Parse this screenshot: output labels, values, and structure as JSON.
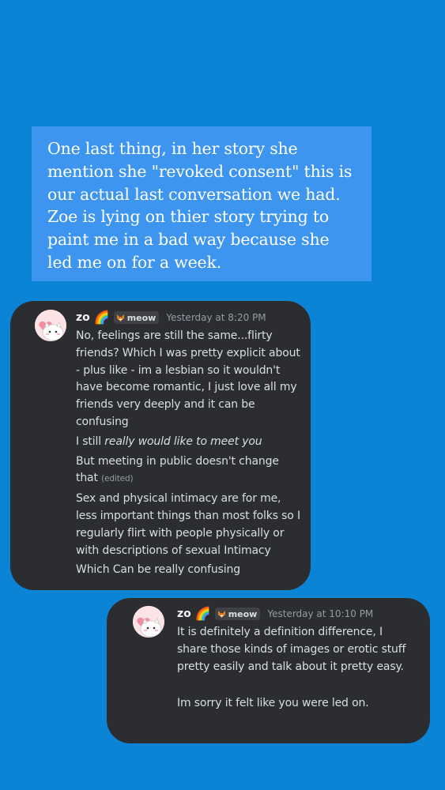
{
  "caption": {
    "text": "One last thing, in her story she mention she \"revoked consent\" this is our actual last conversation we had. Zoe is lying on thier story trying to paint me in a bad way because she led me on for a week."
  },
  "messages": [
    {
      "username": "zo",
      "badge_emoji": "🌈",
      "tag_icon": "fox-icon",
      "tag_label": "meow",
      "timestamp": "Yesterday at 8:20 PM",
      "lines": [
        "No, feelings are still the same...flirty friends? Which I was pretty explicit about -  plus like - im a lesbian so it wouldn't have become romantic, I just love all my friends very deeply and it can be confusing",
        "I still ",
        "really would like to meet you",
        "But meeting in public doesn't change that",
        "(edited)",
        "Sex and physical intimacy are for me, less important things than most folks so I regularly flirt with people physically or with descriptions of sexual Intimacy",
        "Which Can be really confusing"
      ]
    },
    {
      "username": "zo",
      "badge_emoji": "🌈",
      "tag_icon": "fox-icon",
      "tag_label": "meow",
      "timestamp": "Yesterday at 10:10 PM",
      "lines": [
        "It is definitely a definition difference, I share those kinds of images or erotic stuff pretty easily and talk about it pretty easy.",
        "Im sorry it felt like you were led on."
      ]
    }
  ],
  "colors": {
    "background": "#0b84d6",
    "caption_box": "#3d95f0",
    "card": "#2b2d31",
    "text": "#dbdee1",
    "muted": "#949ba4"
  }
}
